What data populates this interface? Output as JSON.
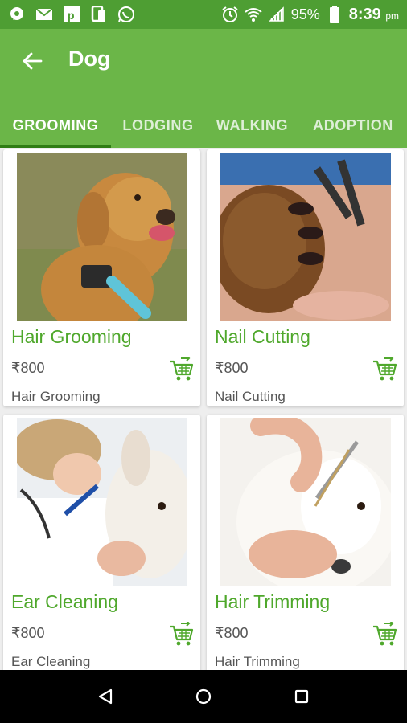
{
  "status_bar": {
    "battery": "95%",
    "time": "8:39",
    "ampm": "pm"
  },
  "app_bar": {
    "title": "Dog",
    "tabs": [
      {
        "label": "GROOMING"
      },
      {
        "label": "LODGING"
      },
      {
        "label": "WALKING"
      },
      {
        "label": "ADOPTION"
      }
    ],
    "active_tab": "GROOMING"
  },
  "services": [
    {
      "name": "Hair Grooming",
      "currency": "₹",
      "price": "800",
      "description": "Hair Grooming",
      "icon": "add-to-cart-icon"
    },
    {
      "name": "Nail Cutting",
      "currency": "₹",
      "price": "800",
      "description": "Nail Cutting",
      "icon": "add-to-cart-icon"
    },
    {
      "name": "Ear Cleaning",
      "currency": "₹",
      "price": "800",
      "description": "Ear Cleaning",
      "icon": "add-to-cart-icon"
    },
    {
      "name": "Hair Trimming",
      "currency": "₹",
      "price": "800",
      "description": "Hair Trimming",
      "icon": "add-to-cart-icon"
    }
  ],
  "colors": {
    "status_bar": "#4e9e33",
    "app_bar": "#6bb648",
    "accent_green": "#4fa82c"
  }
}
